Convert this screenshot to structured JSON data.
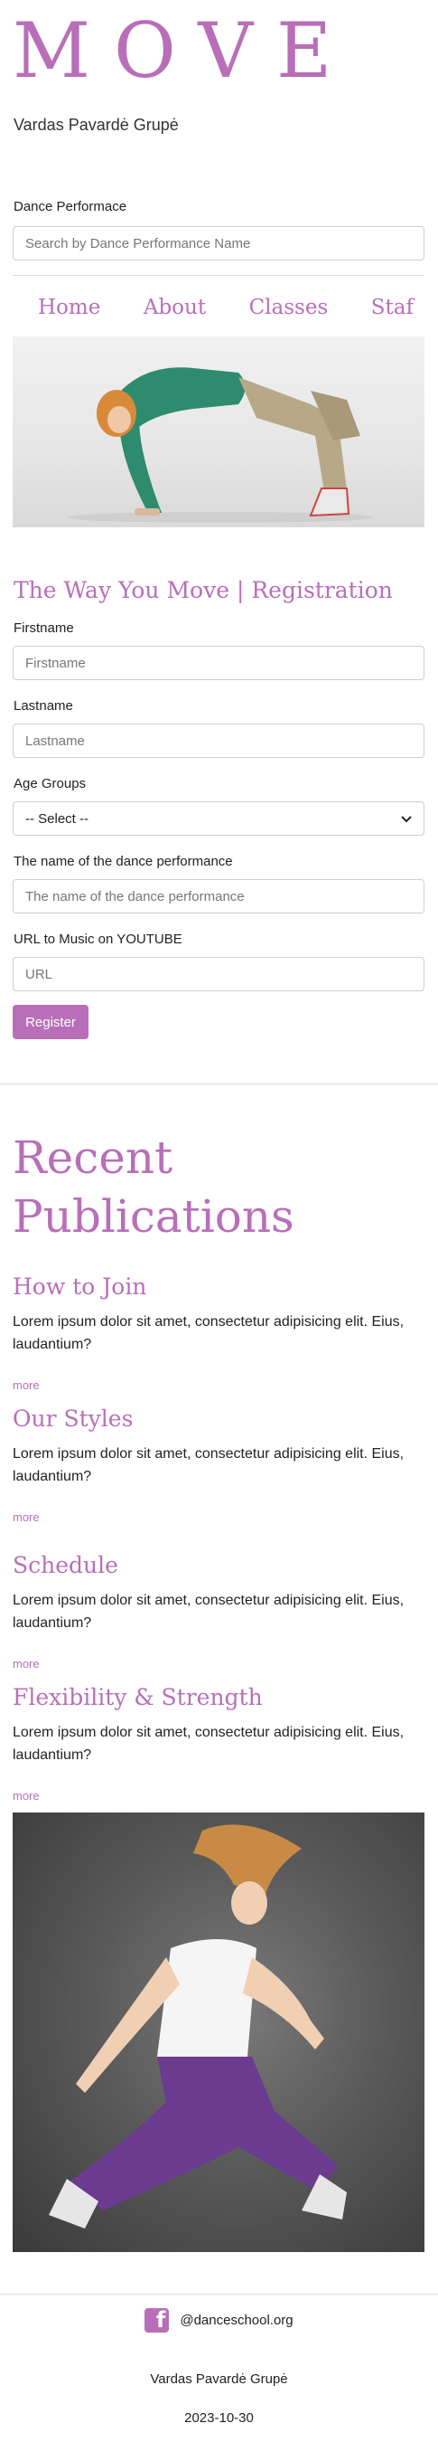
{
  "header": {
    "brand": "MOVE",
    "subtitle": "Vardas Pavardė Grupė"
  },
  "search": {
    "label": "Dance Performace",
    "placeholder": "Search by Dance Performance Name"
  },
  "nav": {
    "items": [
      "Home",
      "About",
      "Classes",
      "Staf"
    ]
  },
  "registration": {
    "title": "The Way You Move | Registration",
    "firstname_label": "Firstname",
    "firstname_placeholder": "Firstname",
    "lastname_label": "Lastname",
    "lastname_placeholder": "Lastname",
    "age_label": "Age Groups",
    "age_selected": "-- Select --",
    "performance_label": "The name of the dance performance",
    "performance_placeholder": "The name of the dance performance",
    "url_label": "URL to Music on YOUTUBE",
    "url_placeholder": "URL",
    "submit_label": "Register"
  },
  "publications": {
    "title": "Recent Publications",
    "items": [
      {
        "title": "How to Join",
        "text": "Lorem ipsum dolor sit amet, consectetur adipisicing elit. Eius, laudantium?",
        "more": "more"
      },
      {
        "title": "Our Styles",
        "text": "Lorem ipsum dolor sit amet, consectetur adipisicing elit. Eius, laudantium?",
        "more": "more"
      },
      {
        "title": "Schedule",
        "text": "Lorem ipsum dolor sit amet, consectetur adipisicing elit. Eius, laudantium?",
        "more": "more"
      },
      {
        "title": "Flexibility & Strength",
        "text": "Lorem ipsum dolor sit amet, consectetur adipisicing elit. Eius, laudantium?",
        "more": "more"
      }
    ]
  },
  "footer": {
    "social_icon": "facebook-icon",
    "handle": "@danceschool.org",
    "name": "Vardas Pavardė Grupė",
    "date": "2023-10-30"
  },
  "colors": {
    "accent": "#b86fb8"
  }
}
